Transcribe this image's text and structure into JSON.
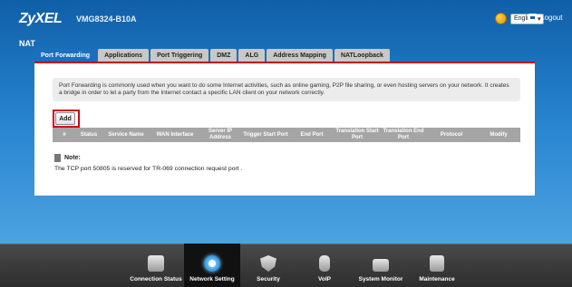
{
  "header": {
    "logo": "ZyXEL",
    "model": "VMG8324-B10A",
    "language": "English",
    "logout": "Logout"
  },
  "page_title": "NAT",
  "tabs": [
    {
      "label": "Port Forwarding",
      "active": true
    },
    {
      "label": "Applications",
      "active": false
    },
    {
      "label": "Port Triggering",
      "active": false
    },
    {
      "label": "DMZ",
      "active": false
    },
    {
      "label": "ALG",
      "active": false
    },
    {
      "label": "Address Mapping",
      "active": false
    },
    {
      "label": "NATLoopback",
      "active": false
    }
  ],
  "description": "Port Forwarding is commonly used when you want to do some Internet activities, such as online gaming, P2P file sharing, or even hosting servers on your network. It creates a bridge in order to let a party from the Internet contact a specific LAN client on your network correctly.",
  "add_button": "Add",
  "table": {
    "columns": [
      "#",
      "Status",
      "Service Name",
      "WAN Interface",
      "Server IP Address",
      "Trigger Start Port",
      "End Port",
      "Translation Start Port",
      "Translation End Port",
      "Protocol",
      "Modify"
    ]
  },
  "note": {
    "title": "Note:",
    "text": "The TCP port 50805 is reserved for TR-069 connection request port ."
  },
  "bottom_nav": [
    {
      "label": "Connection Status",
      "icon": "connection-status-icon",
      "active": false
    },
    {
      "label": "Network Setting",
      "icon": "gear-icon",
      "active": true
    },
    {
      "label": "Security",
      "icon": "shield-icon",
      "active": false
    },
    {
      "label": "VoIP",
      "icon": "phone-icon",
      "active": false
    },
    {
      "label": "System Monitor",
      "icon": "monitor-icon",
      "active": false
    },
    {
      "label": "Maintenance",
      "icon": "tools-icon",
      "active": false
    }
  ],
  "colors": {
    "accent": "#1b6fbd",
    "highlight": "#d0021b"
  }
}
